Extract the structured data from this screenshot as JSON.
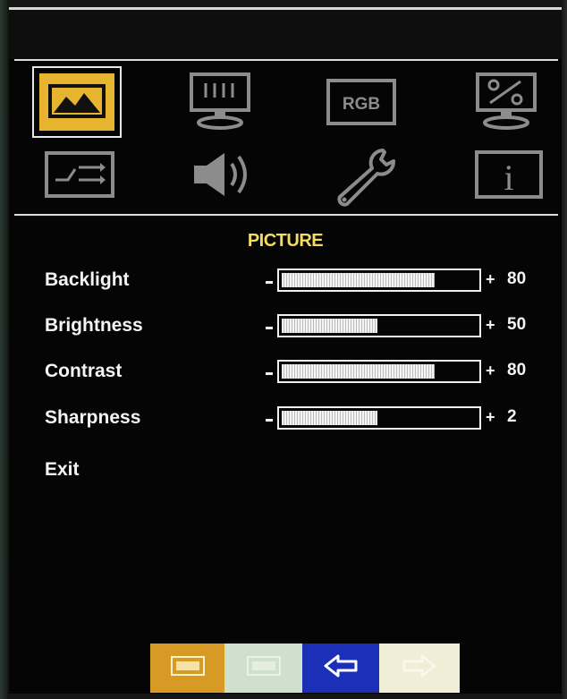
{
  "menu": {
    "title": "PICTURE",
    "tabs": [
      {
        "name": "picture",
        "icon": "picture-mountain-icon",
        "selected": true
      },
      {
        "name": "display",
        "icon": "monitor-icon",
        "selected": false
      },
      {
        "name": "color",
        "icon": "rgb-icon",
        "label": "RGB",
        "selected": false
      },
      {
        "name": "preset",
        "icon": "monitor-percent-icon",
        "selected": false
      },
      {
        "name": "input",
        "icon": "input-switch-icon",
        "selected": false
      },
      {
        "name": "audio",
        "icon": "speaker-icon",
        "selected": false
      },
      {
        "name": "setup",
        "icon": "wrench-icon",
        "selected": false
      },
      {
        "name": "info",
        "icon": "info-icon",
        "label": "i",
        "selected": false
      }
    ]
  },
  "settings": [
    {
      "label": "Backlight",
      "value": "80",
      "level": 0.8
    },
    {
      "label": "Brightness",
      "value": "50",
      "level": 0.5
    },
    {
      "label": "Contrast",
      "value": "80",
      "level": 0.8
    },
    {
      "label": "Sharpness",
      "value": "2",
      "level": 0.5
    }
  ],
  "exit_label": "Exit",
  "symbols": {
    "minus": "−",
    "plus": "+"
  },
  "bottom_buttons": [
    {
      "name": "menu-key",
      "icon": "menu-key-icon",
      "color": "#d69a25",
      "active": true
    },
    {
      "name": "exit-key",
      "icon": "exit-key-icon",
      "color": "#cfe0cc",
      "active": false
    },
    {
      "name": "back-key",
      "icon": "arrow-left-icon",
      "color": "#1b30b7",
      "active": true
    },
    {
      "name": "forward-key",
      "icon": "arrow-right-icon",
      "color": "#f0eed6",
      "active": false
    }
  ],
  "colors": {
    "accent": "#f2dc63",
    "selected_tab_bg": "#e6b42e",
    "text": "#f4f4f4",
    "background": "#050505"
  }
}
